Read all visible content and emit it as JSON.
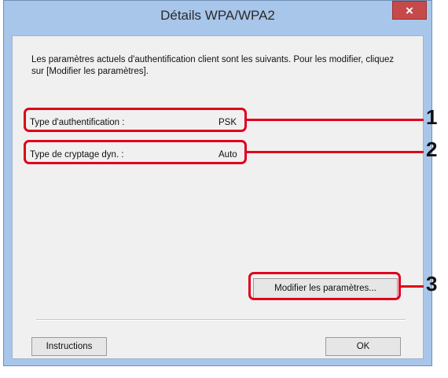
{
  "window": {
    "title": "Détails WPA/WPA2",
    "close_glyph": "×"
  },
  "main": {
    "description": "Les paramètres actuels d'authentification client sont les suivants. Pour les modifier, cliquez sur [Modifier les paramètres].",
    "fields": [
      {
        "label": "Type d'authentification :",
        "value": "PSK"
      },
      {
        "label": "Type de cryptage dyn. :",
        "value": "Auto"
      }
    ],
    "modify_button": "Modifier les paramètres..."
  },
  "footer": {
    "instructions_button": "Instructions",
    "ok_button": "OK"
  },
  "callouts": [
    "1",
    "2",
    "3"
  ],
  "colors": {
    "highlight": "#e0001b",
    "frame": "#a8c6ea",
    "close": "#c74a4a"
  }
}
